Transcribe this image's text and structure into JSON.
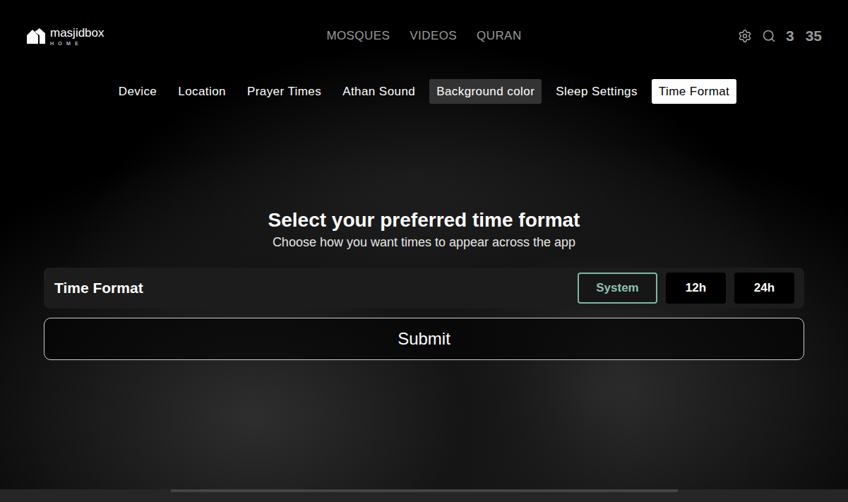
{
  "logo": {
    "name": "masjidbox",
    "sub": "HOME"
  },
  "nav": [
    {
      "label": "MOSQUES"
    },
    {
      "label": "VIDEOS"
    },
    {
      "label": "QURAN"
    }
  ],
  "clock": {
    "hours": "3",
    "minutes": "35"
  },
  "tabs": [
    {
      "label": "Device",
      "selected": false,
      "focused": false
    },
    {
      "label": "Location",
      "selected": false,
      "focused": false
    },
    {
      "label": "Prayer Times",
      "selected": false,
      "focused": false
    },
    {
      "label": "Athan Sound",
      "selected": false,
      "focused": false
    },
    {
      "label": "Background color",
      "selected": false,
      "focused": true
    },
    {
      "label": "Sleep Settings",
      "selected": false,
      "focused": false
    },
    {
      "label": "Time Format",
      "selected": true,
      "focused": false
    }
  ],
  "panel": {
    "title": "Select your preferred time format",
    "subtitle": "Choose how you want times to appear across the app",
    "setting": {
      "label": "Time Format",
      "options": [
        {
          "label": "System",
          "selected": true
        },
        {
          "label": "12h",
          "selected": false
        },
        {
          "label": "24h",
          "selected": false
        }
      ]
    },
    "submit": "Submit"
  }
}
